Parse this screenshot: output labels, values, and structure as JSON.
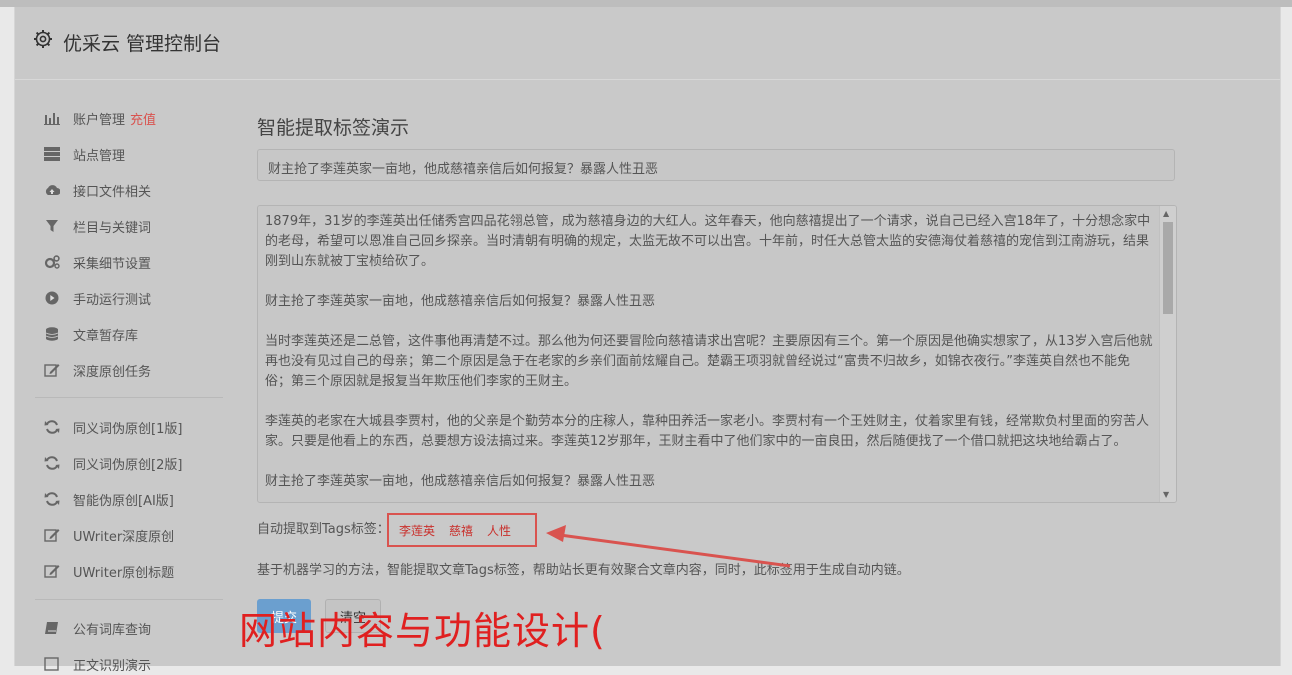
{
  "header": {
    "title": "优采云 管理控制台",
    "icon": "gear-icon"
  },
  "sidebar": {
    "group1": [
      {
        "label": "账户管理",
        "badge": "充值",
        "icon": "bar-chart-icon"
      },
      {
        "label": "站点管理",
        "icon": "server-icon"
      },
      {
        "label": "接口文件相关",
        "icon": "cloud-upload-icon"
      },
      {
        "label": "栏目与关键词",
        "icon": "filter-icon"
      },
      {
        "label": "采集细节设置",
        "icon": "cogs-icon"
      },
      {
        "label": "手动运行测试",
        "icon": "play-circle-icon"
      },
      {
        "label": "文章暂存库",
        "icon": "database-icon"
      },
      {
        "label": "深度原创任务",
        "icon": "edit-icon"
      }
    ],
    "group2": [
      {
        "label": "同义词伪原创[1版]",
        "icon": "refresh-icon"
      },
      {
        "label": "同义词伪原创[2版]",
        "icon": "refresh-icon"
      },
      {
        "label": "智能伪原创[AI版]",
        "icon": "refresh-icon"
      },
      {
        "label": "UWriter深度原创",
        "icon": "edit-icon"
      },
      {
        "label": "UWriter原创标题",
        "icon": "edit-icon"
      }
    ],
    "group3": [
      {
        "label": "公有词库查询",
        "icon": "book-icon"
      },
      {
        "label": "正文识别演示",
        "icon": "square-icon"
      }
    ]
  },
  "main": {
    "heading": "智能提取标签演示",
    "title_value": "财主抢了李莲英家一亩地，他成慈禧亲信后如何报复？暴露人性丑恶",
    "paragraphs": [
      "1879年，31岁的李莲英出任储秀宫四品花翎总管，成为慈禧身边的大红人。这年春天，他向慈禧提出了一个请求，说自己已经入宫18年了，十分想念家中的老母，希望可以恩准自己回乡探亲。当时清朝有明确的规定，太监无故不可以出宫。十年前，时任大总管太监的安德海仗着慈禧的宠信到江南游玩，结果刚到山东就被丁宝桢给砍了。",
      "财主抢了李莲英家一亩地，他成慈禧亲信后如何报复？暴露人性丑恶",
      "当时李莲英还是二总管，这件事他再清楚不过。那么他为何还要冒险向慈禧请求出宫呢？主要原因有三个。第一个原因是他确实想家了，从13岁入宫后他就再也没有见过自己的母亲；第二个原因是急于在老家的乡亲们面前炫耀自己。楚霸王项羽就曾经说过“富贵不归故乡，如锦衣夜行。”李莲英自然也不能免俗；第三个原因就是报复当年欺压他们李家的王财主。",
      "李莲英的老家在大城县李贾村，他的父亲是个勤劳本分的庄稼人，靠种田养活一家老小。李贾村有一个王姓财主，仗着家里有钱，经常欺负村里面的穷苦人家。只要是他看上的东西，总要想方设法搞过来。李莲英12岁那年，王财主看中了他们家中的一亩良田，然后随便找了一个借口就把这块地给霸占了。",
      "财主抢了李莲英家一亩地，他成慈禧亲信后如何报复？暴露人性丑恶"
    ],
    "tags_label": "自动提取到Tags标签：",
    "tags": [
      "李莲英",
      "慈禧",
      "人性"
    ],
    "description": "基于机器学习的方法，智能提取文章Tags标签，帮助站长更有效聚合文章内容，同时，此标签用于生成自动内链。",
    "submit_label": "提交",
    "clear_label": "清空"
  },
  "overlay": {
    "watermark_text": "网站内容与功能设计(",
    "annotation_color": "#d9534f"
  }
}
